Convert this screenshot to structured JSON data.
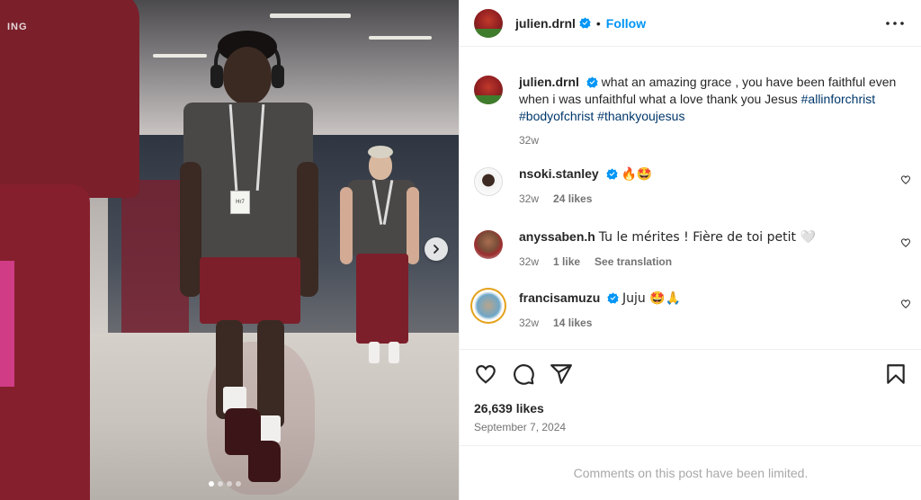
{
  "post": {
    "author": "julien.drnl",
    "follow_label": "Follow",
    "separator": "•",
    "caption_text": "what an amazing grace , you have been faithful even when i was unfaithful what a love thank you Jesus",
    "hashtags": [
      "#allinforchrist",
      "#bodyofchrist",
      "#thankyoujesus"
    ],
    "caption_age": "32w",
    "likes": "26,639 likes",
    "date": "September 7, 2024",
    "comments_limited": "Comments on this post have been limited."
  },
  "media": {
    "lanyard_badge": "Hr7",
    "jacket_text": "ING",
    "carousel_count": 4,
    "carousel_active": 1
  },
  "comments": [
    {
      "user": "nsoki.stanley",
      "verified": true,
      "text": "🔥🤩",
      "age": "32w",
      "likes": "24 likes",
      "extra": ""
    },
    {
      "user": "anyssaben.h",
      "verified": false,
      "text": "Tu le mérites ! Fière de toi petit 🤍",
      "age": "32w",
      "likes": "1 like",
      "extra": "See translation"
    },
    {
      "user": "francisamuzu",
      "verified": true,
      "text": "Juju 🤩🙏",
      "age": "32w",
      "likes": "14 likes",
      "extra": ""
    }
  ],
  "icons": [
    "verified-icon",
    "more-icon",
    "heart-icon",
    "comment-icon",
    "share-icon",
    "bookmark-icon",
    "chevron-right-icon"
  ],
  "colors": {
    "link": "#0095f6",
    "hashtag": "#00376b",
    "muted": "#737373",
    "verified": "#0095f6"
  }
}
